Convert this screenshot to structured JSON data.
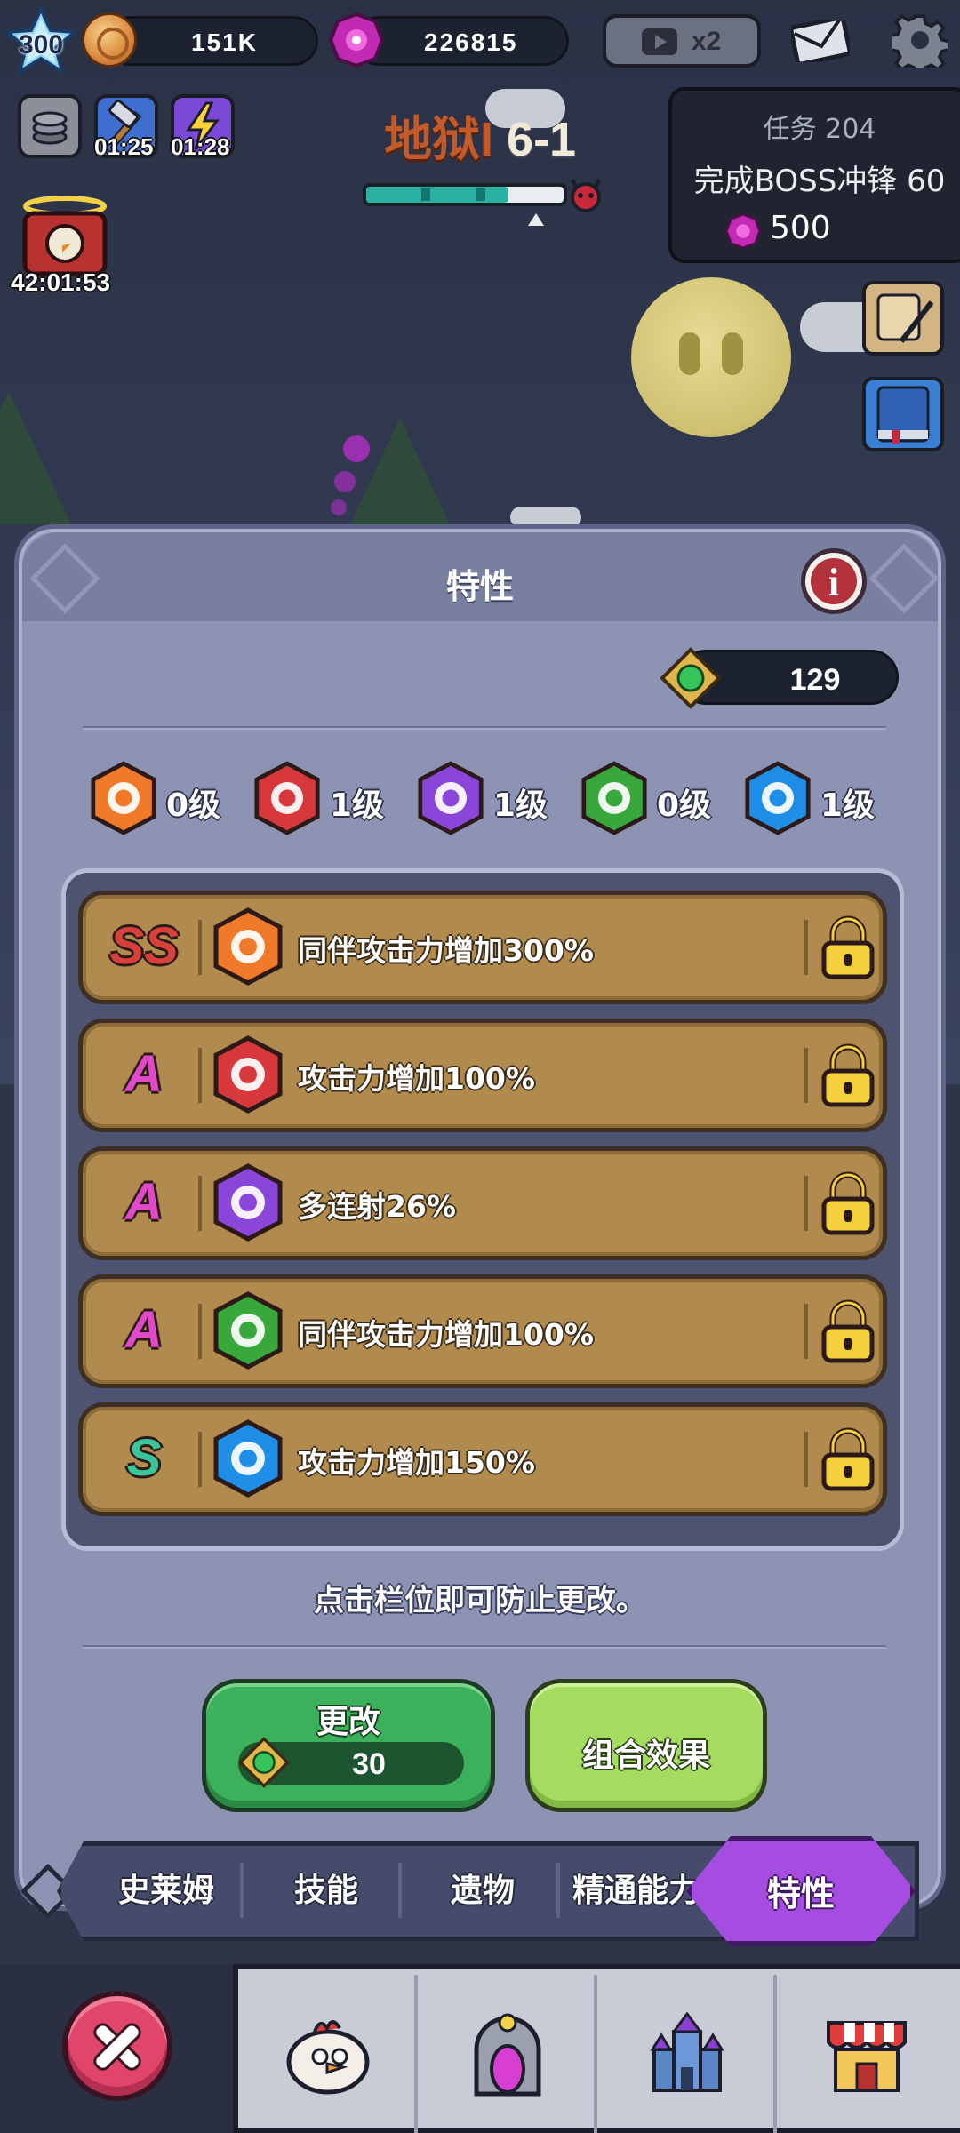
{
  "top": {
    "player_level": "300",
    "coins": "151K",
    "gems": "226815",
    "ad_multiplier": "x2",
    "buff_timers": [
      "01:25",
      "01:28"
    ]
  },
  "stage": {
    "world": "地狱I",
    "number": "6-1",
    "progress": 0.72
  },
  "quest": {
    "title": "任务 204",
    "description": "完成BOSS冲锋 60",
    "reward": "500"
  },
  "chest_timer": "42:01:53",
  "panel": {
    "title": "特性",
    "token_count": "129",
    "grades": [
      {
        "level": "0级",
        "color": "orange"
      },
      {
        "level": "1级",
        "color": "red"
      },
      {
        "level": "1级",
        "color": "purple"
      },
      {
        "level": "0级",
        "color": "green"
      },
      {
        "level": "1级",
        "color": "blue"
      }
    ],
    "slots": [
      {
        "rank": "SS",
        "color": "orange",
        "desc": "同伴攻击力增加300%"
      },
      {
        "rank": "A",
        "color": "red",
        "desc": "攻击力增加100%"
      },
      {
        "rank": "A",
        "color": "purple",
        "desc": "多连射26%"
      },
      {
        "rank": "A",
        "color": "green",
        "desc": "同伴攻击力增加100%"
      },
      {
        "rank": "S",
        "color": "blue",
        "desc": "攻击力增加150%"
      }
    ],
    "hint": "点击栏位即可防止更改。",
    "change_label": "更改",
    "change_cost": "30",
    "combo_label": "组合效果"
  },
  "tabs": [
    "史莱姆",
    "技能",
    "遗物",
    "精通能力",
    "特性"
  ],
  "colors": {
    "orange": "#f07a2a",
    "red": "#d6383c",
    "purple": "#8a46d8",
    "green": "#38a83c",
    "blue": "#1e8ee6",
    "rank_SS": "#d8403a",
    "rank_A": "#e04ac8",
    "rank_S": "#38c59a"
  }
}
